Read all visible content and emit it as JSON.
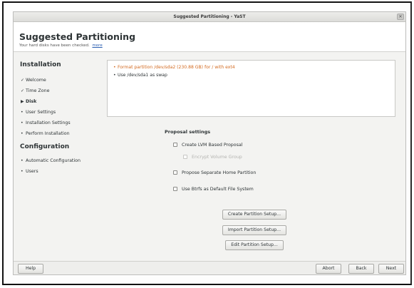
{
  "window": {
    "title": "Suggested Partitioning - YaST",
    "close_glyph": "✕"
  },
  "header": {
    "title": "Suggested Partitioning",
    "subtitle": "Your hard disks have been checked.",
    "more_link": "more"
  },
  "sidebar": {
    "installation_heading": "Installation",
    "installation_items": [
      {
        "mark": "✓",
        "label": "Welcome"
      },
      {
        "mark": "✓",
        "label": "Time Zone"
      },
      {
        "mark": "▶",
        "label": "Disk"
      },
      {
        "mark": "•",
        "label": "User Settings"
      },
      {
        "mark": "•",
        "label": "Installation Settings"
      },
      {
        "mark": "•",
        "label": "Perform Installation"
      }
    ],
    "configuration_heading": "Configuration",
    "configuration_items": [
      {
        "mark": "•",
        "label": "Automatic Configuration"
      },
      {
        "mark": "•",
        "label": "Users"
      }
    ]
  },
  "summary": {
    "items": [
      {
        "bullet": "•",
        "text": "Format partition /dev/sda2 (230.88 GB) for / with ext4"
      },
      {
        "bullet": "•",
        "text": "Use /dev/sda1 as swap"
      }
    ]
  },
  "proposal": {
    "heading": "Proposal settings",
    "options": [
      {
        "label": "Create LVM Based Proposal",
        "checked": false,
        "enabled": true
      },
      {
        "label": "Encrypt Volume Group",
        "checked": false,
        "enabled": false
      },
      {
        "label": "Propose Separate Home Partition",
        "checked": false,
        "enabled": true
      },
      {
        "label": "Use Btrfs as Default File System",
        "checked": false,
        "enabled": true
      }
    ]
  },
  "actions": {
    "create": "Create Partition Setup...",
    "import": "Import Partition Setup...",
    "edit": "Edit Partition Setup..."
  },
  "footer": {
    "help": "Help",
    "abort": "Abort",
    "back": "Back",
    "next": "Next"
  },
  "colors": {
    "warning_text": "#d2691e",
    "link": "#2a5db0"
  }
}
